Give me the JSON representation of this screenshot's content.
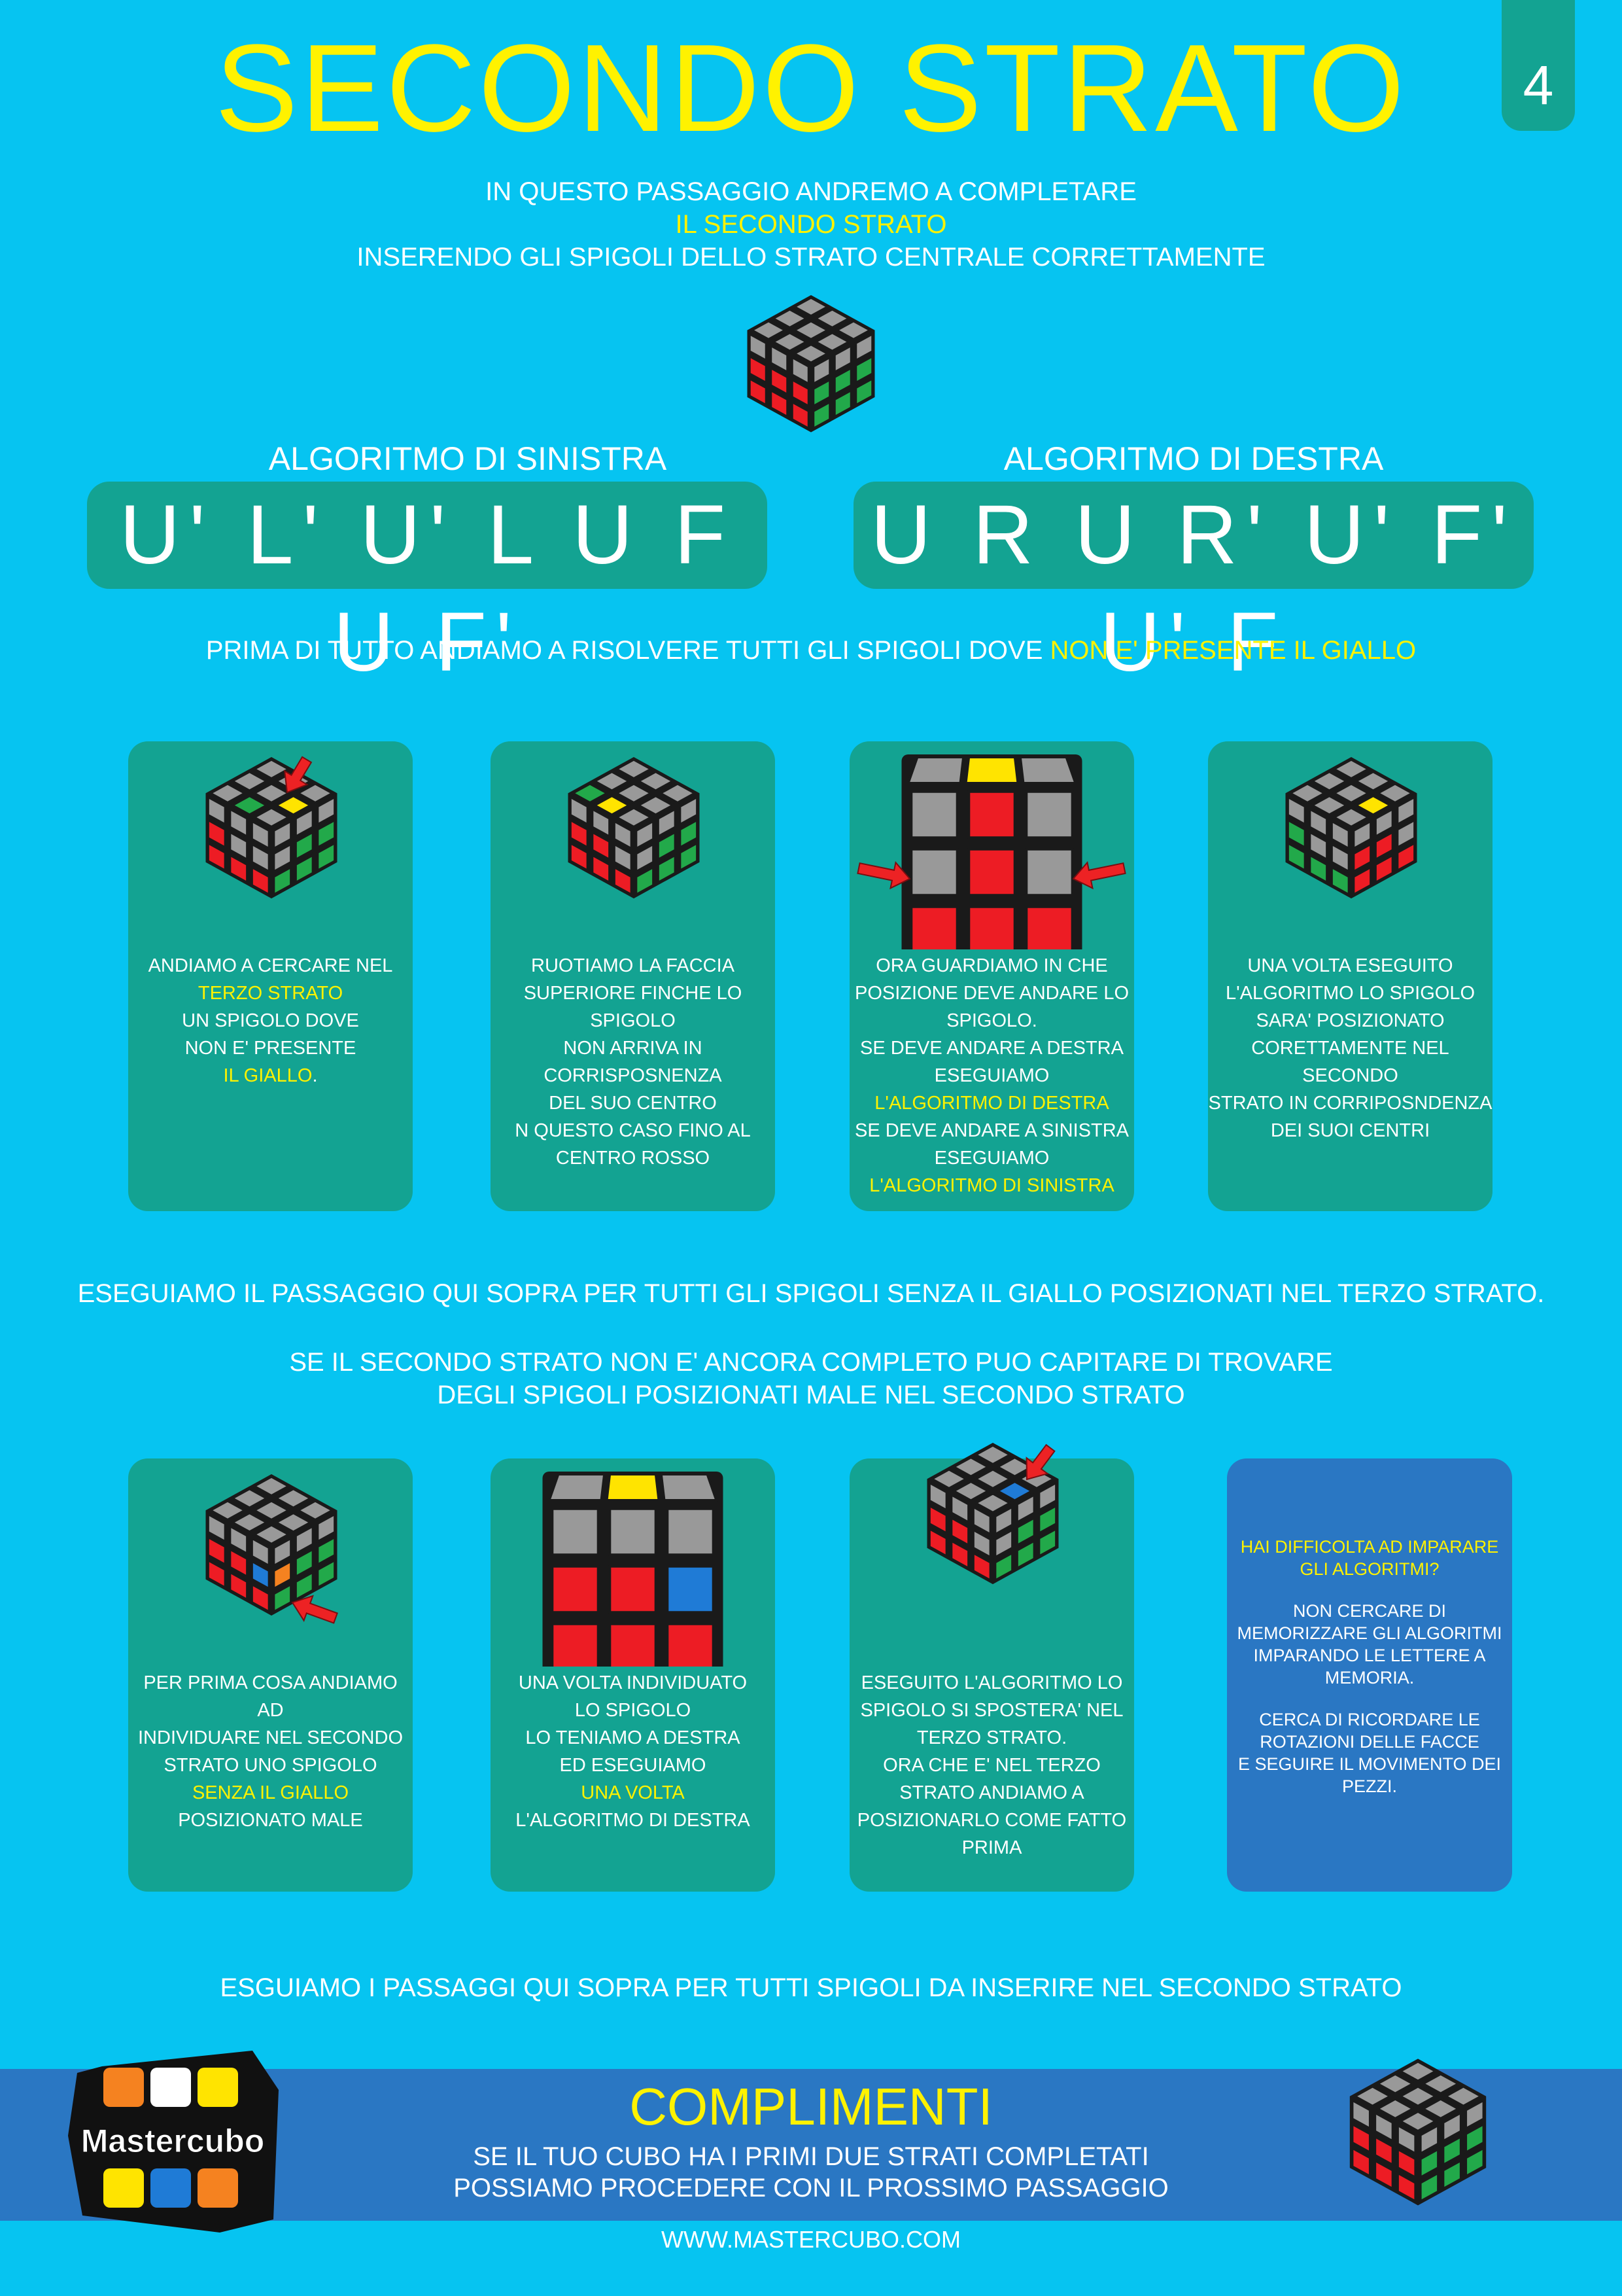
{
  "title": "SECONDO STRATO",
  "step_number": "4",
  "intro": {
    "line1": "IN QUESTO PASSAGGIO ANDREMO A COMPLETARE",
    "line2": "IL SECONDO STRATO",
    "line3": "INSERENDO GLI SPIGOLI DELLO STRATO CENTRALE CORRETTAMENTE"
  },
  "algorithms": {
    "left_label": "ALGORITMO DI SINISTRA",
    "left_moves": "U' L' U' L U F U F'",
    "right_label": "ALGORITMO DI DESTRA",
    "right_moves": "U R U R' U' F' U' F"
  },
  "first_statement": {
    "text": "PRIMA DI TUTTO ANDIAMO A RISOLVERE TUTTI GLI SPIGOLI DOVE ",
    "highlight": "NON E' PRESENTE IL GIALLO"
  },
  "row1_cards": [
    {
      "lines": [
        {
          "t": "ANDIAMO A CERCARE NEL"
        },
        {
          "t": "TERZO STRATO",
          "y": true
        },
        {
          "t": "UN SPIGOLO DOVE"
        },
        {
          "t": "NON E' PRESENTE"
        },
        {
          "t": "IL GIALLO",
          "y": true,
          "tail": "."
        }
      ]
    },
    {
      "lines": [
        {
          "t": "RUOTIAMO LA FACCIA"
        },
        {
          "t": "SUPERIORE FINCHE LO SPIGOLO"
        },
        {
          "t": "NON ARRIVA IN"
        },
        {
          "t": "CORRISPOSNENZA"
        },
        {
          "t": "DEL SUO CENTRO"
        },
        {
          "t": "N QUESTO CASO FINO AL"
        },
        {
          "t": "CENTRO ROSSO"
        }
      ]
    },
    {
      "lines": [
        {
          "t": "ORA GUARDIAMO IN CHE"
        },
        {
          "t": "POSIZIONE DEVE ANDARE LO"
        },
        {
          "t": "SPIGOLO."
        },
        {
          "t": "SE DEVE ANDARE A DESTRA"
        },
        {
          "t": "ESEGUIAMO"
        },
        {
          "t": "L'ALGORITMO DI DESTRA",
          "y": true
        },
        {
          "t": "SE DEVE ANDARE A SINISTRA"
        },
        {
          "t": "ESEGUIAMO"
        },
        {
          "t": "L'ALGORITMO DI SINISTRA",
          "y": true
        }
      ]
    },
    {
      "lines": [
        {
          "t": "UNA VOLTA ESEGUITO"
        },
        {
          "t": "L'ALGORITMO LO SPIGOLO"
        },
        {
          "t": "SARA' POSIZIONATO"
        },
        {
          "t": "CORETTAMENTE NEL SECONDO"
        },
        {
          "t": "STRATO IN CORRIPOSNDENZA"
        },
        {
          "t": "DEI SUOI CENTRI"
        }
      ]
    }
  ],
  "middle_statement": "ESEGUIAMO IL PASSAGGIO QUI SOPRA PER TUTTI GLI SPIGOLI SENZA IL GIALLO POSIZIONATI NEL TERZO STRATO.",
  "second_statement": {
    "line1": "SE IL SECONDO STRATO NON E' ANCORA COMPLETO PUO CAPITARE DI TROVARE",
    "line2": "DEGLI SPIGOLI POSIZIONATI MALE NEL SECONDO STRATO"
  },
  "row2_cards": [
    {
      "lines": [
        {
          "t": "PER PRIMA COSA ANDIAMO AD"
        },
        {
          "t": "INDIVIDUARE  NEL  SECONDO"
        },
        {
          "t": "STRATO UNO SPIGOLO"
        },
        {
          "t": "SENZA IL GIALLO",
          "y": true
        },
        {
          "t": "POSIZIONATO MALE"
        }
      ]
    },
    {
      "lines": [
        {
          "t": "UNA VOLTA INDIVIDUATO"
        },
        {
          "t": "LO SPIGOLO"
        },
        {
          "t": "LO TENIAMO A DESTRA"
        },
        {
          "t": "ED ESEGUIAMO"
        },
        {
          "t": "UNA VOLTA",
          "y": true
        },
        {
          "t": "L'ALGORITMO DI DESTRA"
        }
      ]
    },
    {
      "lines": [
        {
          "t": "ESEGUITO L'ALGORITMO LO"
        },
        {
          "t": "SPIGOLO SI SPOSTERA' NEL"
        },
        {
          "t": "TERZO STRATO."
        },
        {
          "t": "ORA CHE E' NEL TERZO"
        },
        {
          "t": "STRATO ANDIAMO A"
        },
        {
          "t": "POSIZIONARLO COME FATTO"
        },
        {
          "t": "PRIMA"
        }
      ]
    }
  ],
  "tip_card": {
    "heading_line1": "HAI DIFFICOLTA AD IMPARARE",
    "heading_line2": "GLI ALGORITMI?",
    "para1_line1": "NON CERCARE DI",
    "para1_line2": "MEMORIZZARE GLI ALGORITMI",
    "para1_line3": "IMPARANDO LE LETTERE A",
    "para1_line4": "MEMORIA.",
    "para2_line1": "CERCA DI RICORDARE LE",
    "para2_line2": "ROTAZIONI DELLE FACCE",
    "para2_line3": "E SEGUIRE IL MOVIMENTO DEI",
    "para2_line4": "PEZZI."
  },
  "closing_statement": "ESGUIAMO I PASSAGGI QUI SOPRA PER TUTTI SPIGOLI DA INSERIRE NEL SECONDO STRATO",
  "footer": {
    "title": "COMPLIMENTI",
    "line1": "SE IL TUO CUBO HA I PRIMI DUE STRATI COMPLETATI",
    "line2": "POSSIAMO PROCEDERE CON IL PROSSIMO PASSAGGIO",
    "website": "WWW.MASTERCUBO.COM",
    "logo_text": "Mastercubo"
  },
  "colors": {
    "background": "#06c4f1",
    "card": "#13a392",
    "tip_card": "#2a77c3",
    "highlight": "#fff200",
    "cube_gray": "#999999",
    "cube_red": "#ed1c24",
    "cube_green": "#22a94a",
    "cube_yellow": "#ffe400",
    "cube_blue": "#1f7bd6",
    "cube_orange": "#f58220",
    "arrow": "#ed2224"
  }
}
